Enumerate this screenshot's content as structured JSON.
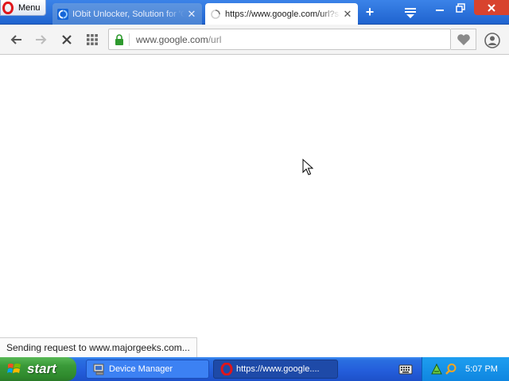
{
  "browser": {
    "menu_label": "Menu",
    "tabs": [
      {
        "title": "IObit Unlocker, Solution for 'Ca",
        "state": "inactive"
      },
      {
        "title": "https://www.google.com/url?sa",
        "state": "active-loading"
      }
    ],
    "new_tab_glyph": "+",
    "address": {
      "domain": "www.google.com",
      "path": "/url"
    },
    "icons": {
      "back": "back-arrow-icon",
      "forward": "forward-arrow-icon",
      "stop": "stop-icon",
      "speed_dial": "grid-icon",
      "lock": "lock-icon",
      "bookmark": "heart-icon",
      "account": "account-icon"
    }
  },
  "page": {
    "status_text": "Sending request to www.majorgeeks.com..."
  },
  "taskbar": {
    "start_label": "start",
    "tasks": [
      {
        "label": "Device Manager",
        "icon": "device-manager-icon"
      },
      {
        "label": "https://www.google....",
        "icon": "opera-icon"
      }
    ],
    "clock": "5:07 PM"
  },
  "colors": {
    "tab_bar": "#2a6fe0",
    "start_green": "#3a9a39",
    "taskbar_blue": "#245edb",
    "tray_blue": "#0f86e0",
    "opera_red": "#e0161b"
  }
}
